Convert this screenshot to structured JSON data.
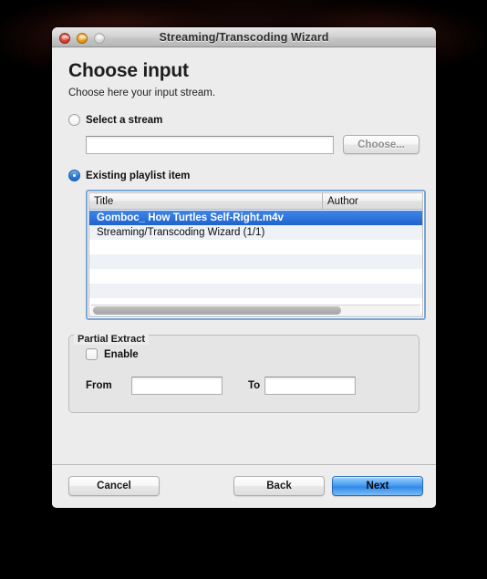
{
  "window": {
    "title": "Streaming/Transcoding Wizard",
    "controls": {
      "close": "close-button",
      "minimize": "minimize-button",
      "zoom": "zoom-button"
    }
  },
  "page": {
    "title": "Choose input",
    "subtitle": "Choose here your input stream."
  },
  "input_source": {
    "select_stream": {
      "label": "Select a stream",
      "selected": false,
      "field_value": "",
      "field_placeholder": "",
      "choose_button": "Choose..."
    },
    "existing_playlist": {
      "label": "Existing playlist item",
      "selected": true
    }
  },
  "playlist_table": {
    "columns": [
      "Title",
      "Author"
    ],
    "rows": [
      {
        "title": "Gomboc_ How Turtles Self-Right.m4v",
        "author": "",
        "selected": true
      },
      {
        "title": "Streaming/Transcoding Wizard (1/1)",
        "author": "",
        "selected": false
      },
      {
        "title": "",
        "author": "",
        "selected": false
      },
      {
        "title": "",
        "author": "",
        "selected": false
      },
      {
        "title": "",
        "author": "",
        "selected": false
      },
      {
        "title": "",
        "author": "",
        "selected": false
      },
      {
        "title": "",
        "author": "",
        "selected": false
      },
      {
        "title": "",
        "author": "",
        "selected": false
      }
    ],
    "scrollbar": "horizontal"
  },
  "partial_extract": {
    "legend": "Partial Extract",
    "enable": {
      "label": "Enable",
      "checked": false
    },
    "from": {
      "label": "From",
      "value": ""
    },
    "to": {
      "label": "To",
      "value": ""
    }
  },
  "footer": {
    "cancel": "Cancel",
    "back": "Back",
    "next": "Next",
    "default_button": "Next"
  },
  "colors": {
    "accent_blue": "#2a7fdb",
    "selection_blue": "#2f72dd",
    "focus_ring": "#79a7d8",
    "window_bg": "#ececec",
    "desktop_bg": "#000000"
  }
}
